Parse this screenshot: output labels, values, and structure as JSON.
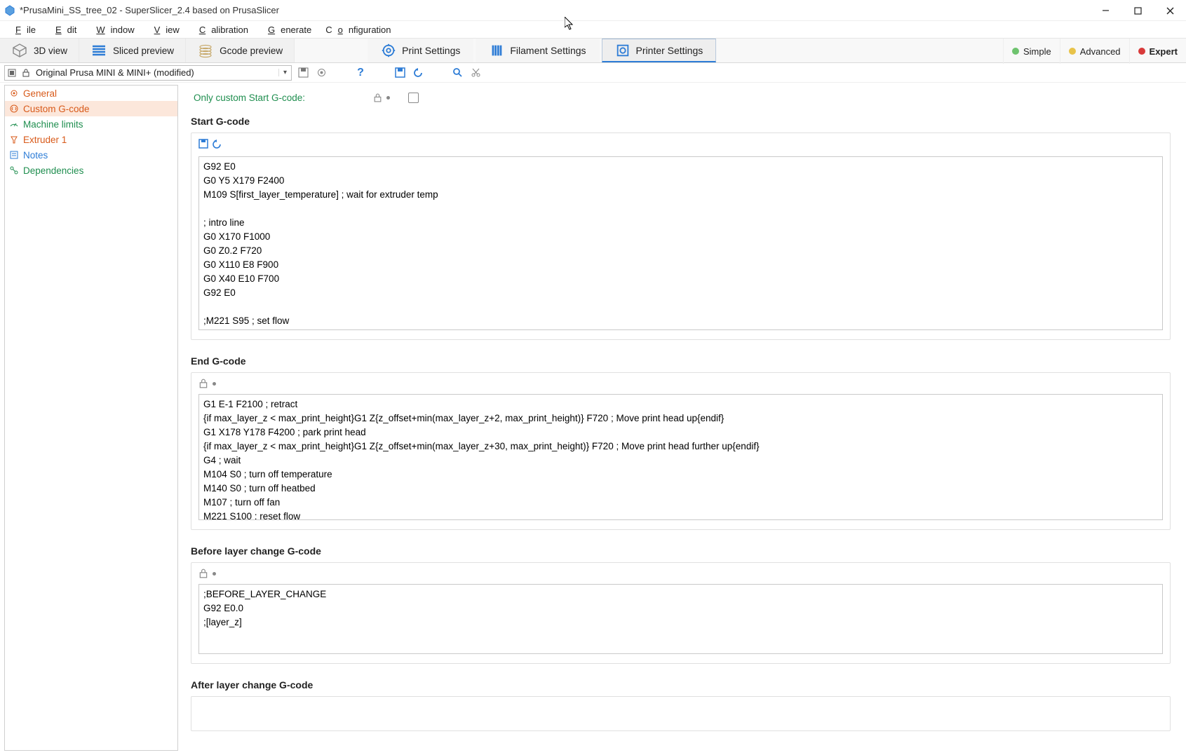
{
  "window": {
    "title": "*PrusaMini_SS_tree_02 - SuperSlicer_2.4  based on PrusaSlicer"
  },
  "menu": {
    "file": "File",
    "edit": "Edit",
    "window": "Window",
    "view": "View",
    "calibration": "Calibration",
    "generate": "Generate",
    "configuration": "Configuration"
  },
  "toolbar": {
    "view3d": "3D view",
    "sliced": "Sliced preview",
    "gcode": "Gcode preview",
    "print": "Print Settings",
    "filament": "Filament Settings",
    "printer": "Printer Settings"
  },
  "modes": {
    "simple": "Simple",
    "advanced": "Advanced",
    "expert": "Expert"
  },
  "preset": {
    "selected": "Original Prusa MINI & MINI+ (modified)"
  },
  "sidebar": {
    "general": "General",
    "custom": "Custom G-code",
    "machine": "Machine limits",
    "extruder": "Extruder 1",
    "notes": "Notes",
    "deps": "Dependencies"
  },
  "content": {
    "only_custom_label": "Only custom Start G-code:",
    "start_header": "Start G-code",
    "start_code": "G92 E0\nG0 Y5 X179 F2400\nM109 S[first_layer_temperature] ; wait for extruder temp\n\n; intro line\nG0 X170 F1000\nG0 Z0.2 F720\nG0 X110 E8 F900\nG0 X40 E10 F700\nG92 E0\n\n;M221 S95 ; set flow",
    "end_header": "End G-code",
    "end_code": "G1 E-1 F2100 ; retract\n{if max_layer_z < max_print_height}G1 Z{z_offset+min(max_layer_z+2, max_print_height)} F720 ; Move print head up{endif}\nG1 X178 Y178 F4200 ; park print head\n{if max_layer_z < max_print_height}G1 Z{z_offset+min(max_layer_z+30, max_print_height)} F720 ; Move print head further up{endif}\nG4 ; wait\nM104 S0 ; turn off temperature\nM140 S0 ; turn off heatbed\nM107 ; turn off fan\nM221 S100 ; reset flow",
    "before_header": "Before layer change G-code",
    "before_code": ";BEFORE_LAYER_CHANGE\nG92 E0.0\n;[layer_z]",
    "after_header": "After layer change G-code"
  },
  "colors": {
    "accent": "#2d7cd6",
    "green": "#1f8e4f",
    "orange": "#d85a1a"
  }
}
